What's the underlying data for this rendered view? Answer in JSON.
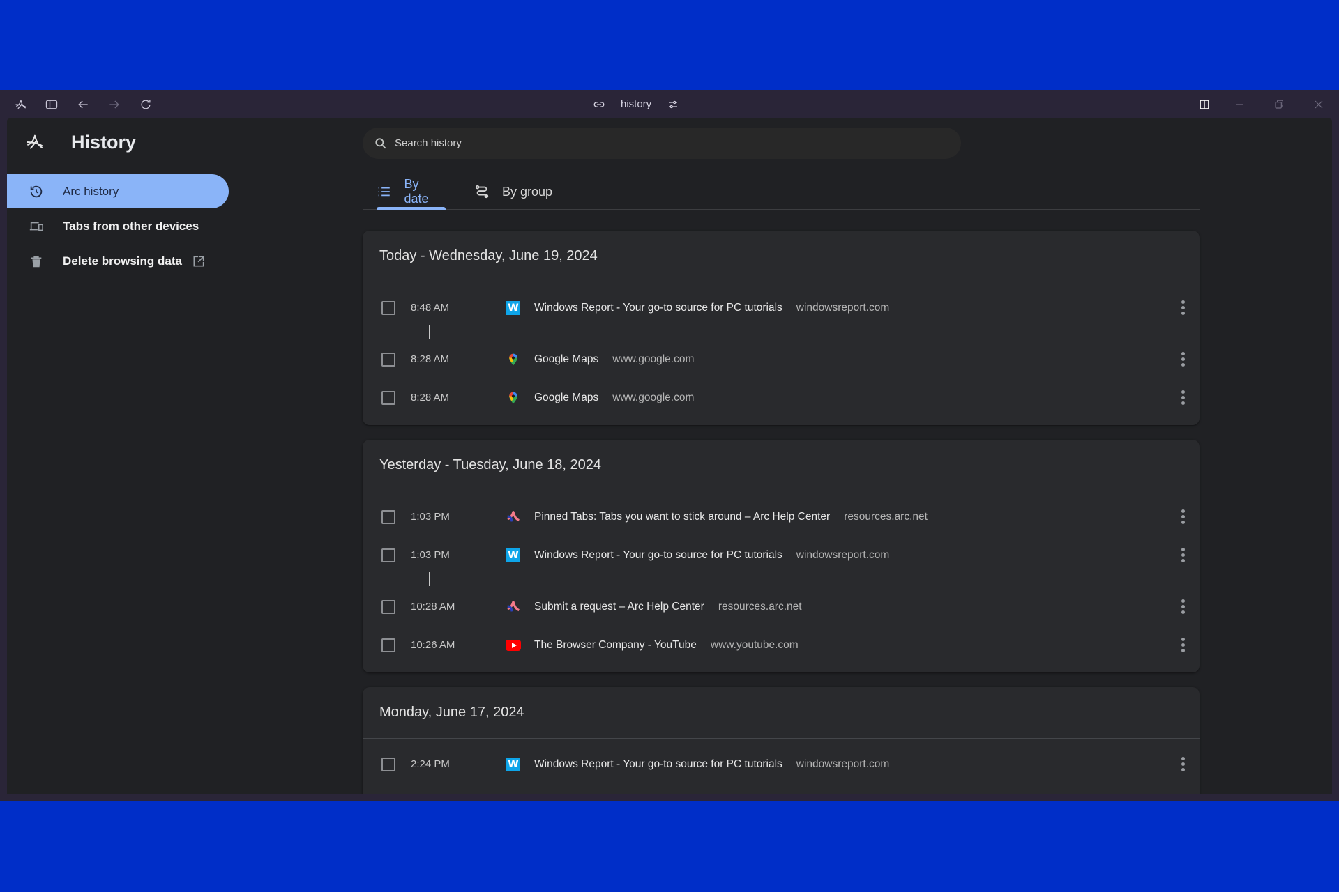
{
  "titlebar": {
    "address": "history",
    "icons": [
      "arc-logo-icon",
      "sidebar-toggle-icon",
      "back-arrow-icon",
      "forward-arrow-icon",
      "reload-icon",
      "link-icon",
      "settings-sliders-icon",
      "split-view-icon",
      "minimize-icon",
      "restore-icon",
      "close-icon"
    ]
  },
  "sidebar": {
    "title": "History",
    "items": [
      {
        "label": "Arc history",
        "icon": "history-clock-icon",
        "active": true
      },
      {
        "label": "Tabs from other devices",
        "icon": "devices-icon",
        "active": false
      },
      {
        "label": "Delete browsing data",
        "icon": "trash-icon",
        "active": false,
        "trailing_icon": "open-external-icon"
      }
    ]
  },
  "search": {
    "placeholder": "Search history",
    "value": ""
  },
  "tabs": [
    {
      "label": "By date",
      "icon": "list-icon",
      "active": true
    },
    {
      "label": "By group",
      "icon": "route-icon",
      "active": false
    }
  ],
  "colors": {
    "accent": "#8ab4f8",
    "background": "#002ec8",
    "pane": "#202124",
    "card": "#292a2d"
  },
  "days": [
    {
      "heading": "Today - Wednesday, June 19, 2024",
      "entries": [
        {
          "time": "8:48 AM",
          "title": "Windows Report - Your go-to source for PC tutorials",
          "domain": "windowsreport.com",
          "favicon": "windowsreport"
        },
        {
          "time": "8:28 AM",
          "title": "Google Maps",
          "domain": "www.google.com",
          "favicon": "google-maps"
        },
        {
          "time": "8:28 AM",
          "title": "Google Maps",
          "domain": "www.google.com",
          "favicon": "google-maps"
        }
      ]
    },
    {
      "heading": "Yesterday - Tuesday, June 18, 2024",
      "entries": [
        {
          "time": "1:03 PM",
          "title": "Pinned Tabs: Tabs you want to stick around – Arc Help Center",
          "domain": "resources.arc.net",
          "favicon": "arc"
        },
        {
          "time": "1:03 PM",
          "title": "Windows Report - Your go-to source for PC tutorials",
          "domain": "windowsreport.com",
          "favicon": "windowsreport"
        },
        {
          "time": "10:28 AM",
          "title": "Submit a request – Arc Help Center",
          "domain": "resources.arc.net",
          "favicon": "arc"
        },
        {
          "time": "10:26 AM",
          "title": "The Browser Company - YouTube",
          "domain": "www.youtube.com",
          "favicon": "youtube"
        }
      ]
    },
    {
      "heading": "Monday, June 17, 2024",
      "entries": [
        {
          "time": "2:24 PM",
          "title": "Windows Report - Your go-to source for PC tutorials",
          "domain": "windowsreport.com",
          "favicon": "windowsreport"
        }
      ]
    }
  ]
}
